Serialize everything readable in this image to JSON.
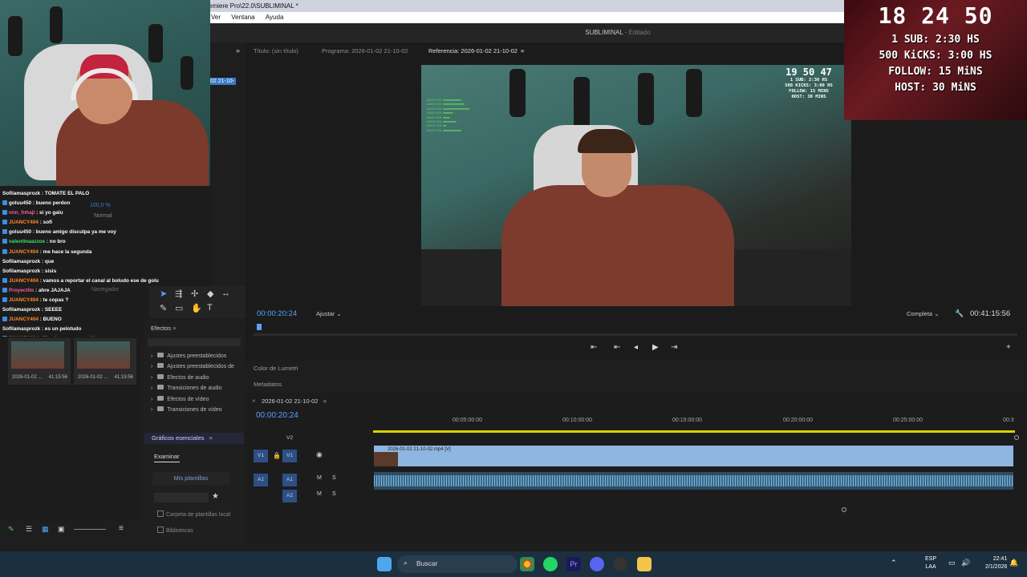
{
  "window": {
    "title": "emiere Pro\\22.0\\SUBLIMINAL *",
    "project": "SUBLIMINAL",
    "project_state": "Editado"
  },
  "menu": [
    "Ver",
    "Ventana",
    "Ayuda"
  ],
  "monitor_tabs": {
    "title": "Título: (sin título)",
    "program": "Programa: 2026-01-02 21-10-02",
    "reference": "Referencia: 2026-01-02 21-10-02"
  },
  "monitor": {
    "timecode_current": "00:00:20:24",
    "fit": "Ajustar",
    "quality": "Completa",
    "timecode_total": "00:41:15:56"
  },
  "panels": {
    "lumetri": "Color de Lumetri",
    "metadata": "Metadatos",
    "effects": "Efectos",
    "graphics": "Gráficos esenciales",
    "navigator": "Navegador",
    "normal": "Normal",
    "sequence_tag": "02 21-10-"
  },
  "effects_items": [
    "Ajustes preestablecidos",
    "Ajustes preestablecidos de",
    "Efectos de audio",
    "Transiciones de audio",
    "Efectos de vídeo",
    "Transiciones de vídeo"
  ],
  "graphics": {
    "tab": "Examinar",
    "button": "Mis plantillas",
    "check1": "Carpeta de plantillas local",
    "check2": "Bibliotecas"
  },
  "thumbs": [
    {
      "name": "2026-01-02 ...",
      "duration": "41:15:56"
    },
    {
      "name": "2026-01-02 ...",
      "duration": "41:15:56"
    }
  ],
  "timeline": {
    "sequence": "2026-01-02 21-10-02",
    "timecode": "00:00:20:24",
    "ruler": [
      "00:05:00:00",
      "00:10:00:00",
      "00:15:00:00",
      "00:20:00:00",
      "00:25:00:00",
      "00:3"
    ],
    "tracks": {
      "v2": "V2",
      "v1": "V1",
      "a1": "A1",
      "a2": "A2"
    },
    "clip_label": "2026-01-02 21-10-02.mp4 [V]"
  },
  "chat": [
    {
      "user": "Sofilamasprozk",
      "msg": "TOMATE EL PALO",
      "color": "#ffffff",
      "icon": ""
    },
    {
      "user": "goluu450",
      "msg": "bueno perdon",
      "color": "#ffffff",
      "icon": "#3b8ee8"
    },
    {
      "user": "nnn_fnhaji",
      "msg": "si yo galu",
      "color": "#ff5aa0",
      "icon": "#3b8ee8"
    },
    {
      "user": "JUANCY404",
      "msg": "sofi",
      "color": "#ff8a2a",
      "icon": "#3b8ee8"
    },
    {
      "user": "goluu450",
      "msg": "bueno amigo disculpa ya me voy",
      "color": "#ffffff",
      "icon": "#3b8ee8"
    },
    {
      "user": "valentinaazzoe",
      "msg": "no bro",
      "color": "#37e06a",
      "icon": "#3b8ee8"
    },
    {
      "user": "JUANCY404",
      "msg": "me hace la segunda",
      "color": "#ff8a2a",
      "icon": "#3b8ee8"
    },
    {
      "user": "Sofilamasprozk",
      "msg": "que",
      "color": "#ffffff",
      "icon": ""
    },
    {
      "user": "Sofilamasprozk",
      "msg": "sisis",
      "color": "#ffffff",
      "icon": ""
    },
    {
      "user": "JUANCY404",
      "msg": "vamos a reportar el canal al boludo ese de golu",
      "color": "#ff8a2a",
      "icon": "#3b8ee8"
    },
    {
      "user": "Proyectito",
      "msg": "ahre JAJAJA",
      "color": "#ff5aa0",
      "icon": "#3b8ee8"
    },
    {
      "user": "JUANCY404",
      "msg": "te copas ?",
      "color": "#ff8a2a",
      "icon": "#3b8ee8"
    },
    {
      "user": "Sofilamasprozk",
      "msg": "SEEEE",
      "color": "#ffffff",
      "icon": ""
    },
    {
      "user": "JUANCY404",
      "msg": "BUENO",
      "color": "#ff8a2a",
      "icon": "#3b8ee8"
    },
    {
      "user": "Sofilamasprozk",
      "msg": "es un pelotudo",
      "color": "#ffffff",
      "icon": ""
    },
    {
      "user": "JUANCY404",
      "msg": "literal se parece a chino",
      "color": "#ff8a2a",
      "icon": "#3b8ee8"
    }
  ],
  "overlay": {
    "timer": "18 24 50",
    "lines": [
      "1 SUB: 2:30 HS",
      "500 KiCKS: 3:00 HS",
      "FOLLOW: 15 MiNS",
      "HOST: 30 MiNS"
    ]
  },
  "video_overlay": {
    "timer": "19 50 47",
    "lines": [
      "1 SUB: 2:30 HS",
      "500 KICKS: 3:00 HS",
      "FOLLOW: 15 MINS",
      "HOST: 30 MINS"
    ]
  },
  "taskbar": {
    "search": "Buscar",
    "lang_top": "ESP",
    "lang_bottom": "LAA",
    "time": "22:41",
    "date": "2/1/2026"
  }
}
